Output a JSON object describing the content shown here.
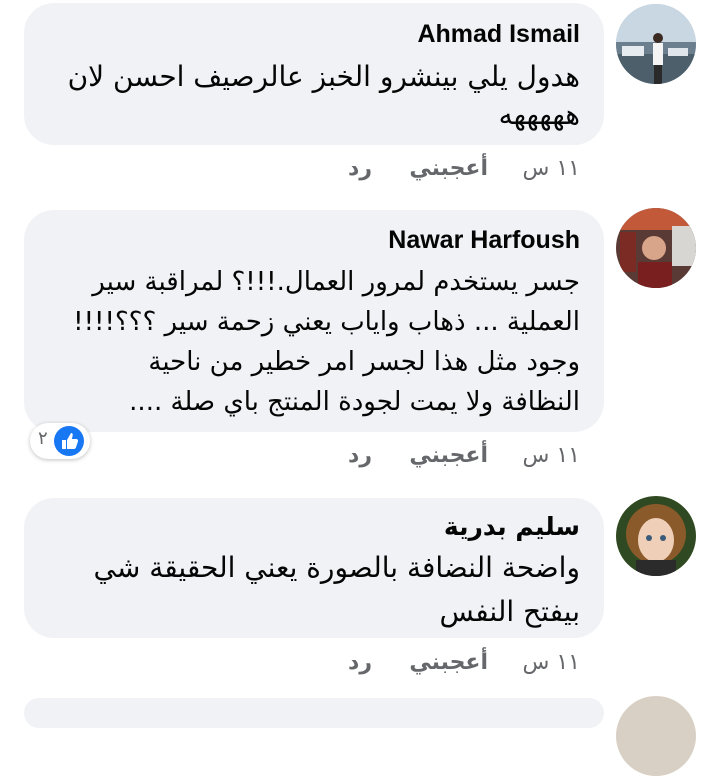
{
  "comments": [
    {
      "author": "Ahmad Ismail",
      "text": "هدول يلي بينشرو الخبز عالرصيف احسن لان\nهههههه",
      "time": "١١ س",
      "like_label": "أعجبني",
      "reply_label": "رد"
    },
    {
      "author": "Nawar Harfoush",
      "text": "جسر يستخدم لمرور العمال.!!!؟ لمراقبة سير\nالعملية ... ذهاب واياب يعني زحمة سير ؟؟؟!!!!\nوجود مثل هذا لجسر امر خطير من ناحية\nالنظافة ولا يمت لجودة المنتج باي صلة ....",
      "time": "١١ س",
      "like_label": "أعجبني",
      "reply_label": "رد",
      "reaction_count": "٢"
    },
    {
      "author": "سليم بدرية",
      "text": "واضحة النضافة بالصورة يعني الحقيقة شي\nبيفتح النفس",
      "time": "١١ س",
      "like_label": "أعجبني",
      "reply_label": "رد"
    }
  ],
  "colors": {
    "bubble": "#f0f2f5",
    "meta_text": "#65676b",
    "like_blue": "#1877f2"
  }
}
